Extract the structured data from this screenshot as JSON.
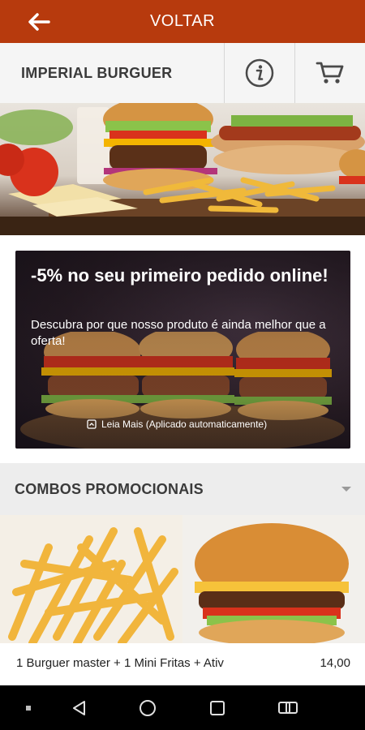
{
  "topbar": {
    "back_icon": "arrow-left-icon",
    "title": "VOLTAR"
  },
  "store": {
    "name": "IMPERIAL BURGUER",
    "info_icon": "info-icon",
    "cart_icon": "cart-icon"
  },
  "promo": {
    "title": "-5% no seu primeiro pedido online!",
    "description": "Descubra por que nosso produto é ainda melhor que a oferta!",
    "more_label": "Leia Mais (Aplicado automaticamente)"
  },
  "section": {
    "title": "COMBOS PROMOCIONAIS",
    "chevron_icon": "chevron-down-icon"
  },
  "products": [
    {
      "name": "1 Burguer master + 1 Mini Fritas + Ativ",
      "price": "14,00"
    }
  ],
  "colors": {
    "brand": "#b73a0d",
    "section_bg": "#ededed",
    "nav_bg": "#000000"
  }
}
